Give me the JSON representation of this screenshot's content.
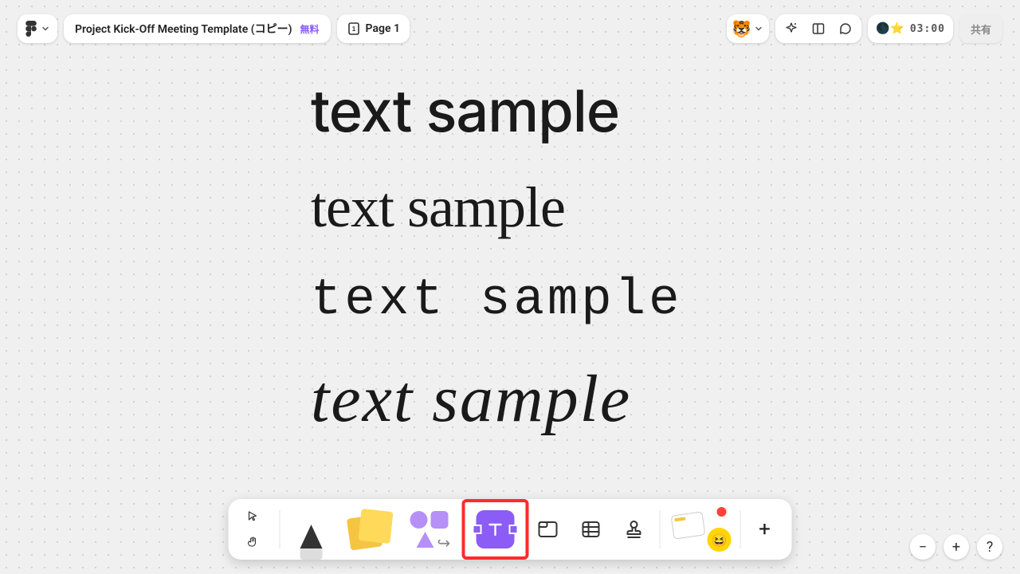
{
  "header": {
    "project_title": "Project Kick-Off Meeting Template (コピー)",
    "free_badge": "無料",
    "page_label": "Page 1"
  },
  "top_right": {
    "timer": "03:00",
    "share_label": "共有"
  },
  "canvas": {
    "text_sans": "text sample",
    "text_serif": "text sample",
    "text_mono": "text sample",
    "text_hand": "text sample"
  },
  "toolbar": {
    "plus": "+"
  },
  "zoom": {
    "minus": "−",
    "plus": "+",
    "help": "?"
  }
}
